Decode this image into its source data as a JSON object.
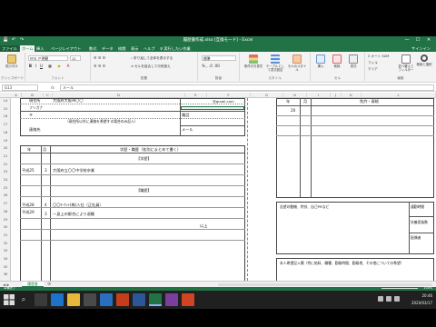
{
  "titlebar": {
    "title": "履歴書作成.xlsx [互換モード] - Excel",
    "qat_save": "💾",
    "qat_undo": "↶",
    "qat_redo": "↷",
    "minimize": "—",
    "maximize": "☐",
    "close": "✕"
  },
  "tabs": {
    "file": "ファイル",
    "home": "ホーム",
    "insert": "挿入",
    "page_layout": "ページレイアウト",
    "formulas": "数式",
    "data": "データ",
    "review": "校閲",
    "view": "表示",
    "help": "ヘルプ",
    "tell_me": "♀ 実行したい作業",
    "signin": "サインイン"
  },
  "ribbon": {
    "paste": "貼り付け",
    "clipboard": "クリップボード",
    "font_name": "ＭＳ Ｐ明朝",
    "font_size": "11",
    "font_group": "フォント",
    "wrap_text": "折り返して全体を表示する",
    "merge_center": "セルを結合して中央揃え",
    "alignment_group": "配置",
    "number_format": "標準",
    "number_group": "数値",
    "conditional": "条件付き書式",
    "table_format": "テーブルとして書式設定",
    "cell_styles": "セルのスタイル",
    "styles_group": "スタイル",
    "insert_cells": "挿入",
    "delete_cells": "削除",
    "format_cells": "書式",
    "cells_group": "セル",
    "autosum": "Σ オート SUM",
    "fill": "フィル",
    "clear": "クリア",
    "sort_filter": "並べ替えとフィルター",
    "find_select": "検索と選択",
    "editing_group": "編集"
  },
  "formula_bar": {
    "name_box": "G13",
    "fx": "fx",
    "value": "メール"
  },
  "columns": [
    "A",
    "B",
    "C",
    "D",
    "E",
    "F",
    "G",
    "H",
    "I",
    "J",
    "K",
    "L",
    "M",
    "N",
    "O",
    "P"
  ],
  "rows": [
    "14",
    "15",
    "16",
    "17",
    "18",
    "19",
    "20",
    "21",
    "22",
    "23",
    "24",
    "25",
    "26",
    "27",
    "28",
    "29",
    "30",
    "31",
    "32",
    "33",
    "34",
    "35",
    "36"
  ],
  "resume": {
    "address_label": "現住所",
    "address_value": "大阪府大阪市〇〇",
    "furigana_label": "フリガナ",
    "contact_label": "連絡先",
    "contact_note": "（現住所以外に連絡を希望する場合のみ記入）",
    "phone_label": "電話",
    "email_label": "メール",
    "email_value": "@gmail.com",
    "year_header": "年",
    "month_header": "月",
    "history_header": "学歴・職歴（各別にまとめて書く）",
    "education_title": "【学歴】",
    "edu_year": "平成25",
    "edu_month": "3",
    "edu_text": "大阪府立〇〇中学校卒業",
    "work_title": "【職歴】",
    "work1_year": "平成28",
    "work1_month": "4",
    "work1_text": "〇〇ﾏｰｹｯﾄ(株)入社（正社員）",
    "work2_year": "平成29",
    "work2_month": "3",
    "work2_text": "一身上の都合により退職",
    "end_text": "以上",
    "right_year_header": "年",
    "right_month_header": "月",
    "license_header": "免許・資格",
    "license_year": "20",
    "motivation_label": "志望の動機、特技、自己PRなど",
    "commute_label": "通勤時間",
    "dependents_label": "扶養家族数",
    "spouse_label": "配偶者",
    "wish_label": "本人希望記入欄（特に給料、職種、勤務時間、勤務地、その他についての希望）"
  },
  "sheet_tab": "履歴書",
  "status": {
    "ready": "準備完了",
    "zoom": "100%"
  },
  "taskbar": {
    "time": "20:46",
    "date": "2020/03/17"
  }
}
